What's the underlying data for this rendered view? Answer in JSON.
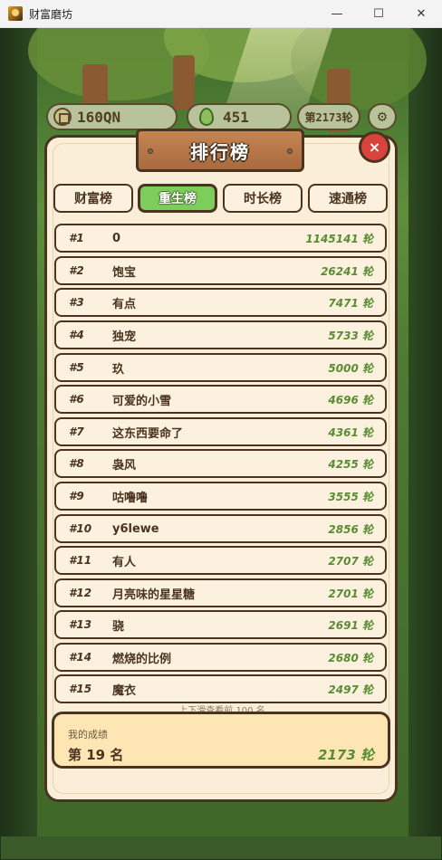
{
  "window": {
    "title": "财富磨坊",
    "controls": {
      "minimize": "—",
      "maximize": "☐",
      "close": "✕"
    }
  },
  "hud": {
    "coins": "160QN",
    "seeds": "451",
    "round": "第2173轮",
    "settings_icon": "gear-icon"
  },
  "leaderboard": {
    "title": "排行榜",
    "close_label": "×",
    "tabs": [
      {
        "label": "财富榜",
        "active": false
      },
      {
        "label": "重生榜",
        "active": true
      },
      {
        "label": "时长榜",
        "active": false
      },
      {
        "label": "速通榜",
        "active": false
      }
    ],
    "rows": [
      {
        "rank": "#1",
        "name": "0",
        "score": "1145141 轮"
      },
      {
        "rank": "#2",
        "name": "饱宝",
        "score": "26241 轮"
      },
      {
        "rank": "#3",
        "name": "有点",
        "score": "7471 轮"
      },
      {
        "rank": "#4",
        "name": "独宠",
        "score": "5733 轮"
      },
      {
        "rank": "#5",
        "name": "玖",
        "score": "5000 轮"
      },
      {
        "rank": "#6",
        "name": "可爱的小雪",
        "score": "4696 轮"
      },
      {
        "rank": "#7",
        "name": "这东西要命了",
        "score": "4361 轮"
      },
      {
        "rank": "#8",
        "name": "袅风",
        "score": "4255 轮"
      },
      {
        "rank": "#9",
        "name": "咕噜噜",
        "score": "3555 轮"
      },
      {
        "rank": "#10",
        "name": "y6lewe",
        "score": "2856 轮"
      },
      {
        "rank": "#11",
        "name": "有人",
        "score": "2707 轮"
      },
      {
        "rank": "#12",
        "name": "月亮味的星星糖",
        "score": "2701 轮"
      },
      {
        "rank": "#13",
        "name": "骁",
        "score": "2691 轮"
      },
      {
        "rank": "#14",
        "name": "燃烧的比例",
        "score": "2680 轮"
      },
      {
        "rank": "#15",
        "name": "魔衣",
        "score": "2497 轮"
      }
    ],
    "scroll_hint": "上下滑查看前 100 名",
    "mine": {
      "label": "我的成绩",
      "rank": "第 19 名",
      "score": "2173 轮"
    }
  }
}
